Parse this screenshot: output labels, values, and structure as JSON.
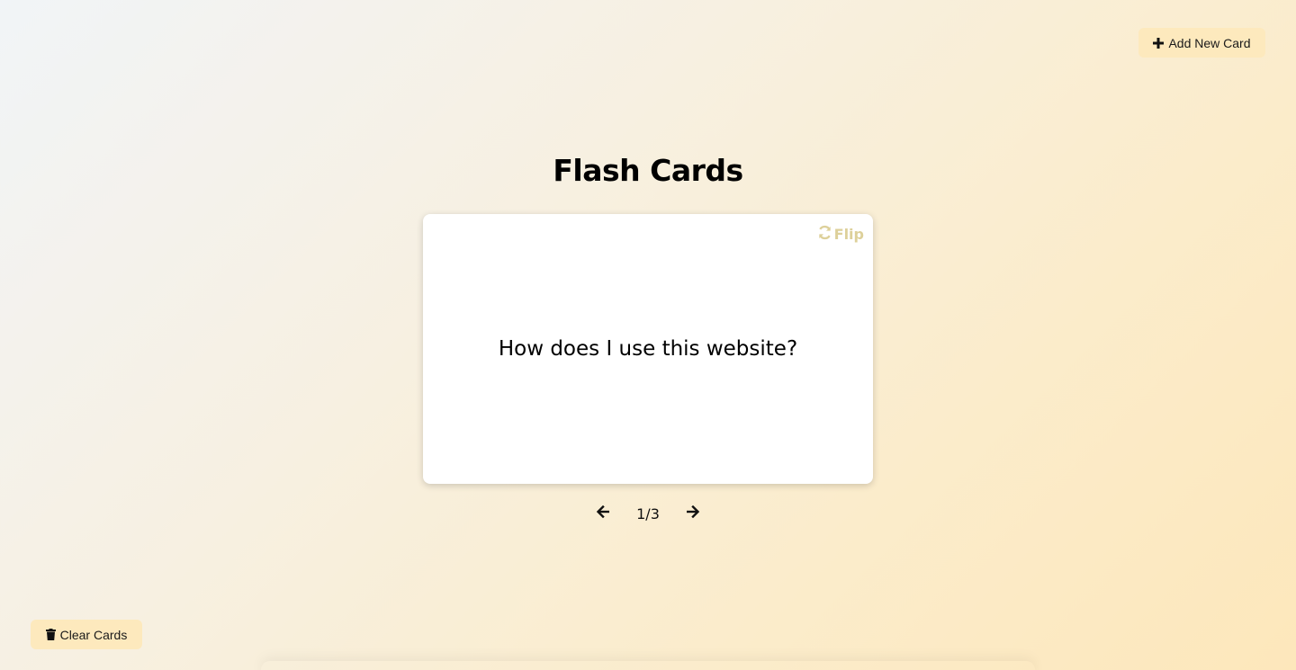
{
  "header": {
    "add_button_label": "Add New Card"
  },
  "title": "Flash Cards",
  "card": {
    "flip_label": "Flip",
    "question": "How does I use this website?"
  },
  "navigation": {
    "counter": "1/3",
    "current": 1,
    "total": 3
  },
  "footer": {
    "clear_button_label": "Clear Cards"
  },
  "icons": {
    "add": "plus-icon",
    "flip": "refresh-icon",
    "prev": "arrow-left-icon",
    "next": "arrow-right-icon",
    "clear": "trash-icon"
  },
  "colors": {
    "button_bg": "#fde9bd",
    "flip_text": "#ddd09a",
    "card_bg": "#ffffff"
  }
}
